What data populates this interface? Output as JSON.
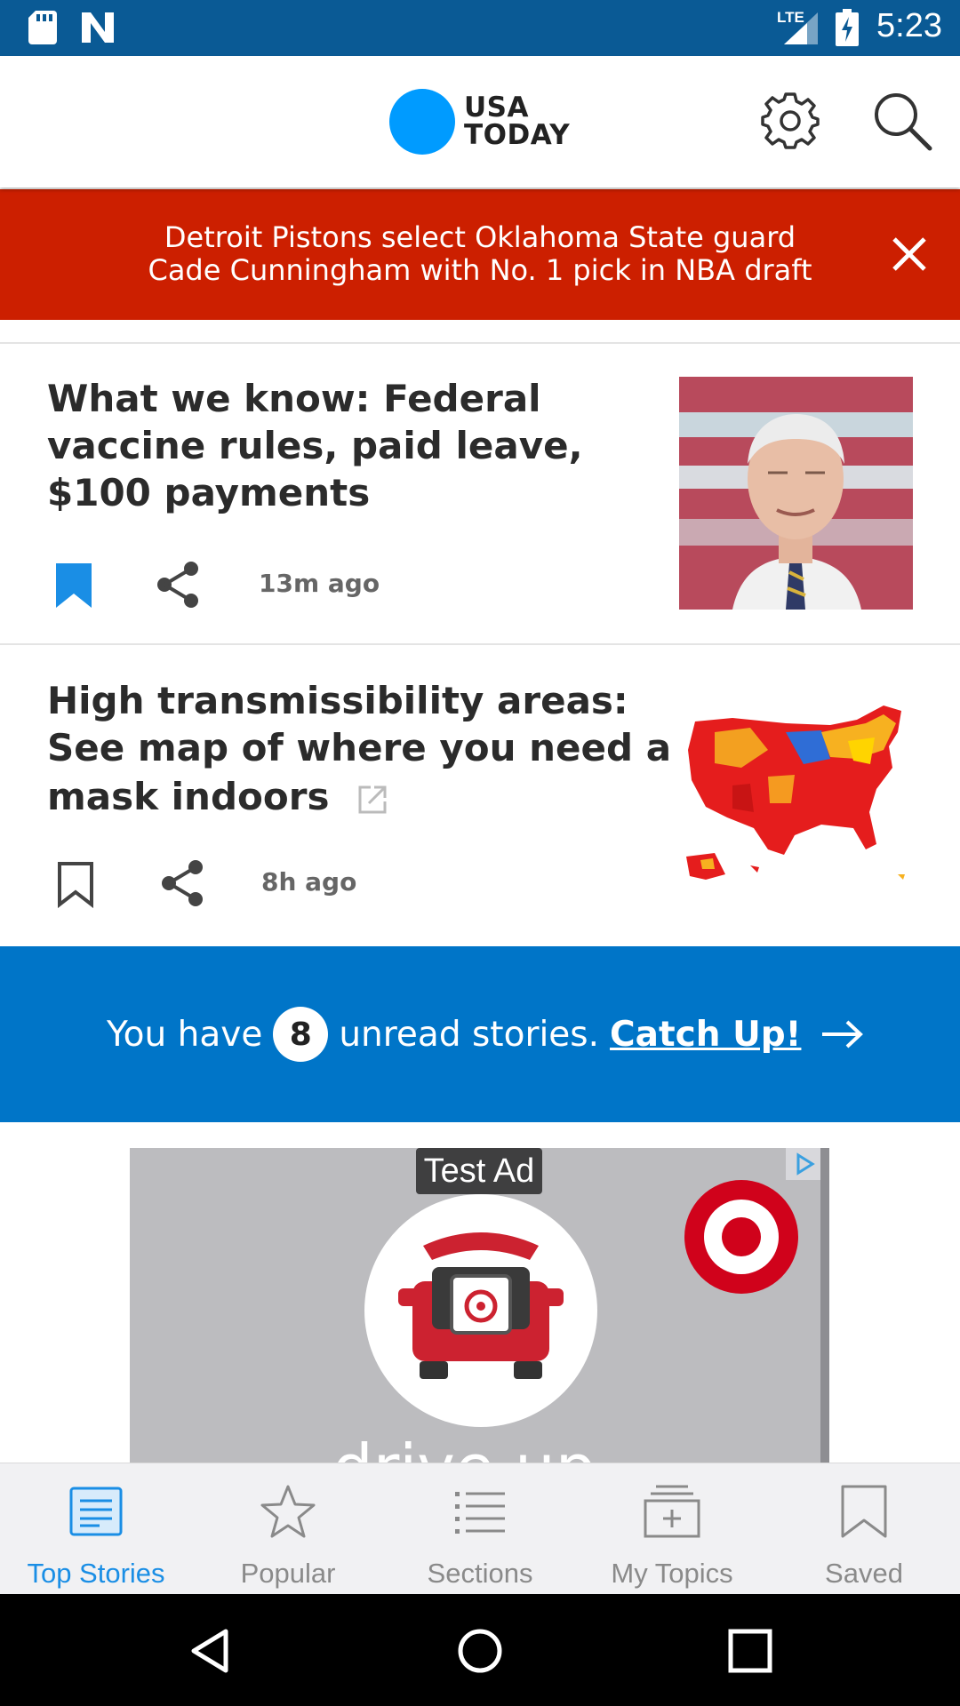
{
  "status_bar": {
    "network": "LTE",
    "time": "5:23",
    "icons": [
      "sd-card-icon",
      "n-notification-icon",
      "signal-icon",
      "battery-charging-icon"
    ]
  },
  "app_bar": {
    "logo_line1": "USA",
    "logo_line2": "TODAY",
    "brand_color": "#009bff",
    "icons": [
      "gear-icon",
      "search-icon"
    ]
  },
  "breaking_banner": {
    "line1": "Detroit Pistons select Oklahoma State guard",
    "line2": "Cade Cunningham with No. 1 pick in NBA draft",
    "color": "#cc1f00"
  },
  "stories": [
    {
      "title_lines": [
        "What we know: Federal",
        "vaccine rules, paid leave,",
        "$100 payments"
      ],
      "time": "13m ago",
      "bookmarked": true,
      "external": false,
      "image": "portrait-photo"
    },
    {
      "title_lines": [
        "High transmissibility areas:",
        "See map of where you need a",
        "mask indoors"
      ],
      "time": "8h ago",
      "bookmarked": false,
      "external": true,
      "image": "us-map-illustration"
    }
  ],
  "catchup": {
    "prefix": "You have",
    "count": "8",
    "suffix": "unread stories.",
    "link": "Catch Up!",
    "color": "#0075c8"
  },
  "ad": {
    "label": "Test Ad",
    "partial_text": "drive up"
  },
  "bottom_nav": {
    "items": [
      {
        "label": "Top Stories",
        "icon": "article-icon",
        "active": true
      },
      {
        "label": "Popular",
        "icon": "star-icon",
        "active": false
      },
      {
        "label": "Sections",
        "icon": "list-icon",
        "active": false
      },
      {
        "label": "My Topics",
        "icon": "add-folder-icon",
        "active": false
      },
      {
        "label": "Saved",
        "icon": "bookmark-icon",
        "active": false
      }
    ],
    "active_color": "#1a8ee5"
  },
  "system_nav": [
    "back-icon",
    "home-icon",
    "recents-icon"
  ]
}
